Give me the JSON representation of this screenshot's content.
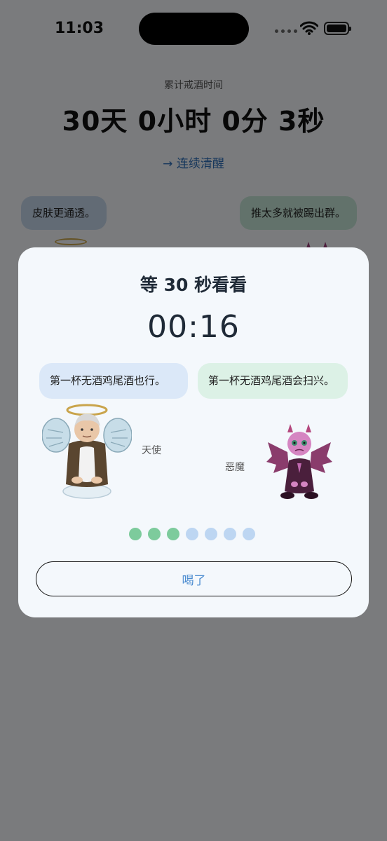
{
  "status_bar": {
    "time": "11:03"
  },
  "background": {
    "label": "累计戒酒时间",
    "counter": "30天 0小时 0分 3秒",
    "link": "→ 连续清醒",
    "left_bubble": "皮肤更通透。",
    "right_bubble": "推太多就被踢出群。"
  },
  "modal": {
    "title": "等 30 秒看看",
    "timer": "00:16",
    "angel": {
      "message": "第一杯无酒鸡尾酒也行。",
      "label": "天使",
      "icon": "angel-character-icon"
    },
    "devil": {
      "message": "第一杯无酒鸡尾酒会扫兴。",
      "label": "恶魔",
      "icon": "devil-character-icon"
    },
    "progress": {
      "completed": 3,
      "total": 7,
      "color_done": "#7dcb9c",
      "color_pending": "#bdd6f2"
    },
    "button_label": "喝了"
  }
}
